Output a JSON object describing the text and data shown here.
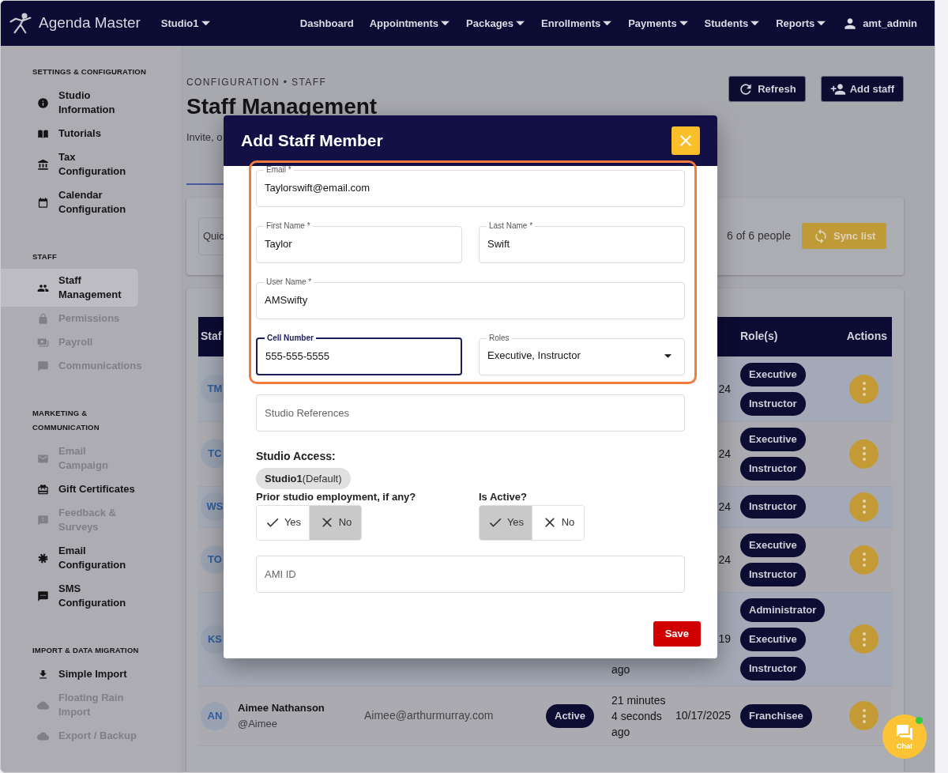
{
  "navbar": {
    "brand": "Agenda Master",
    "studio_menu": "Studio1",
    "links": [
      {
        "label": "Dashboard",
        "dropdown": false
      },
      {
        "label": "Appointments",
        "dropdown": true
      },
      {
        "label": "Packages",
        "dropdown": true
      },
      {
        "label": "Enrollments",
        "dropdown": true
      },
      {
        "label": "Payments",
        "dropdown": true
      },
      {
        "label": "Students",
        "dropdown": true
      },
      {
        "label": "Reports",
        "dropdown": true
      }
    ],
    "user": "amt_admin"
  },
  "sidebar": {
    "sections": [
      {
        "heading": "SETTINGS & CONFIGURATION",
        "items": [
          {
            "label": "Studio Information",
            "selected": false,
            "disabled": false
          },
          {
            "label": "Tutorials",
            "selected": false,
            "disabled": false
          },
          {
            "label": "Tax Configuration",
            "selected": false,
            "disabled": false
          },
          {
            "label": "Calendar Configuration",
            "selected": false,
            "disabled": false
          }
        ]
      },
      {
        "heading": "STAFF",
        "items": [
          {
            "label": "Staff Management",
            "selected": true,
            "disabled": false
          },
          {
            "label": "Permissions",
            "selected": false,
            "disabled": true
          },
          {
            "label": "Payroll",
            "selected": false,
            "disabled": true
          },
          {
            "label": "Communications",
            "selected": false,
            "disabled": true
          }
        ]
      },
      {
        "heading": "MARKETING & COMMUNICATION",
        "items": [
          {
            "label": "Email Campaign",
            "selected": false,
            "disabled": true
          },
          {
            "label": "Gift Certificates",
            "selected": false,
            "disabled": false
          },
          {
            "label": "Feedback & Surveys",
            "selected": false,
            "disabled": true
          },
          {
            "label": "Email Configuration",
            "selected": false,
            "disabled": false
          },
          {
            "label": "SMS Configuration",
            "selected": false,
            "disabled": false
          }
        ]
      },
      {
        "heading": "IMPORT & DATA MIGRATION",
        "items": [
          {
            "label": "Simple Import",
            "selected": false,
            "disabled": false
          },
          {
            "label": "Floating Rain Import",
            "selected": false,
            "disabled": true
          },
          {
            "label": "Export / Backup",
            "selected": false,
            "disabled": true
          }
        ]
      }
    ]
  },
  "page": {
    "breadcrumb": "CONFIGURATION • STAFF",
    "title": "Staff Management",
    "subtitle": "Invite, o",
    "buttons": [
      "Refresh",
      "Add staff"
    ]
  },
  "filter_bar": {
    "search_placeholder": "Quic",
    "count": "6 of 6 people",
    "sync_button": "Sync list"
  },
  "table": {
    "columns": [
      "Staf",
      "Role(s)",
      "Actions"
    ],
    "rows": [
      {
        "initials": "TM",
        "date": "24",
        "roles": [
          "Executive",
          "Instructor"
        ]
      },
      {
        "initials": "TC",
        "date": "24",
        "roles": [
          "Executive",
          "Instructor"
        ]
      },
      {
        "initials": "WS",
        "date": "24",
        "roles": [
          "Instructor"
        ]
      },
      {
        "initials": "TO",
        "date": "24",
        "roles": [
          "Executive",
          "Instructor"
        ]
      },
      {
        "initials": "KS",
        "last_seen": "ago",
        "date": "19",
        "roles": [
          "Administrator",
          "Executive",
          "Instructor"
        ]
      },
      {
        "initials": "AN",
        "name": "Aimee Nathanson",
        "username": "@Aimee",
        "email": "Aimee@arthurmurray.com",
        "status": "Active",
        "last_seen": "21 minutes 4 seconds ago",
        "date": "10/17/2025",
        "roles": [
          "Franchisee"
        ]
      }
    ]
  },
  "modal": {
    "title": "Add Staff Member",
    "email": {
      "label": "Email *",
      "value": "Taylorswift@email.com",
      "focused": false
    },
    "first_name": {
      "label": "First Name *",
      "value": "Taylor",
      "focused": false
    },
    "last_name": {
      "label": "Last Name *",
      "value": "Swift",
      "focused": false
    },
    "user_name": {
      "label": "User Name *",
      "value": "AMSwifty",
      "focused": false
    },
    "cell_number": {
      "label": "Cell Number",
      "value": "555-555-5555",
      "focused": true
    },
    "roles": {
      "label": "Roles",
      "value": "Executive, Instructor"
    },
    "studio_references": {
      "placeholder": "Studio References"
    },
    "studio_access": {
      "label": "Studio Access:",
      "chips": [
        "**Studio1**(Default)"
      ]
    },
    "prior_employment": {
      "label": "Prior studio employment, if any?",
      "options": [
        {
          "label": "Yes",
          "selected": false
        },
        {
          "label": "No",
          "selected": true
        }
      ]
    },
    "is_active": {
      "label": "Is Active?",
      "options": [
        {
          "label": "Yes",
          "selected": true
        },
        {
          "label": "No",
          "selected": false
        }
      ]
    },
    "ami_id": {
      "placeholder": "AMI ID"
    },
    "save_button": "Save"
  },
  "chat": {
    "label": "Chat",
    "online": true
  }
}
